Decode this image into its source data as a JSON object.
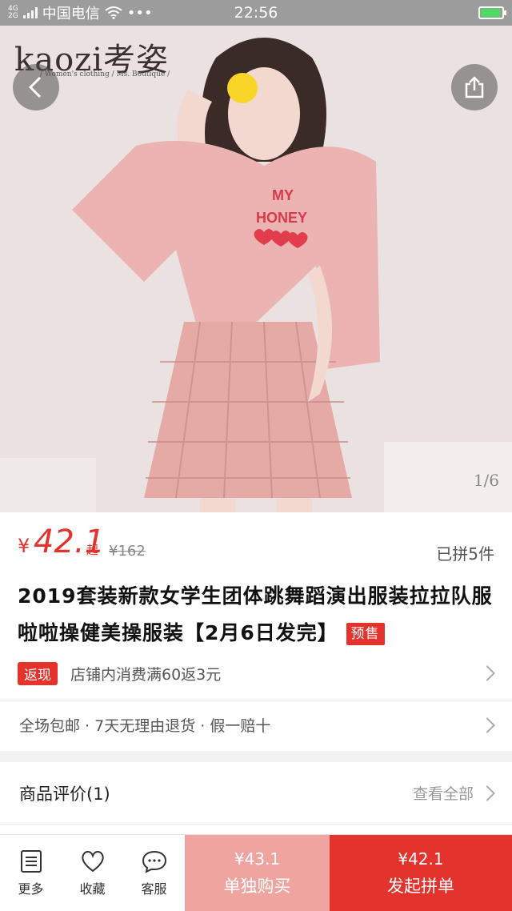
{
  "status_bar": {
    "network_top": "4G",
    "network_bottom": "2G",
    "carrier": "中国电信",
    "dots": "•••",
    "time": "22:56"
  },
  "hero": {
    "logo_text": "kaozi考姿",
    "logo_subtitle": "/ Women's clothing / Ms. Boutique /",
    "shirt_text_1": "MY",
    "shirt_text_2": "HONEY",
    "page_indicator": "1/6"
  },
  "price": {
    "currency": "¥",
    "value": "42.1",
    "suffix": "起",
    "original": "¥162",
    "sold": "已拼5件"
  },
  "product": {
    "title": "2019套装新款女学生团体跳舞蹈演出服装拉拉队服啦啦操健美操服装【2月6日发完】",
    "presale_tag": "预售"
  },
  "promo": {
    "tag": "返现",
    "text": "店铺内消费满60返3元"
  },
  "service": {
    "text": "全场包邮 · 7天无理由退货 · 假一赔十"
  },
  "reviews": {
    "title": "商品评价(1)",
    "view_all": "查看全部"
  },
  "bottom_bar": {
    "more": "更多",
    "favorite": "收藏",
    "service": "客服",
    "single_price": "¥43.1",
    "single_label": "单独购买",
    "group_price": "¥42.1",
    "group_label": "发起拼单"
  },
  "colors": {
    "accent_red": "#e3332c",
    "light_red": "#f0a4a0"
  }
}
